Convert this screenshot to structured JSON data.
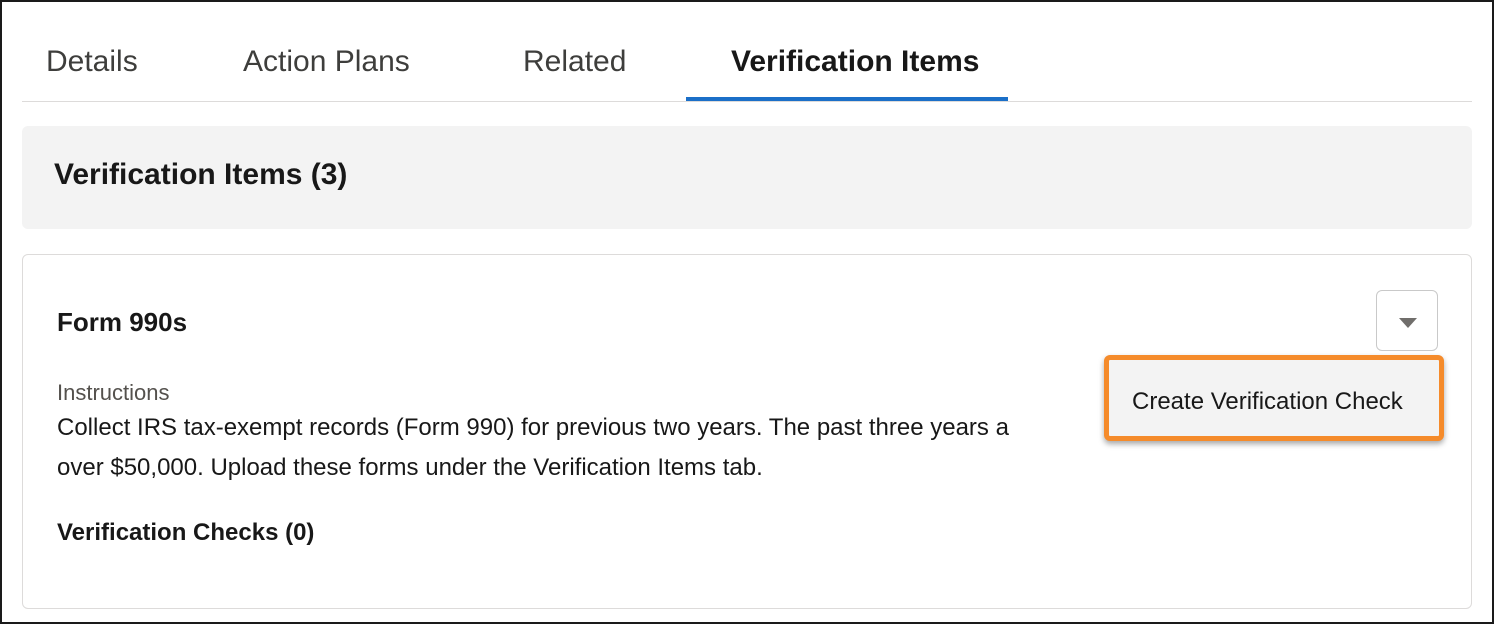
{
  "tabs": {
    "items": [
      {
        "label": "Details"
      },
      {
        "label": "Action Plans"
      },
      {
        "label": "Related"
      },
      {
        "label": "Verification Items"
      }
    ],
    "active": "Verification Items",
    "accent_color": "#1b6fc8"
  },
  "list": {
    "title": "Verification Items (3)"
  },
  "card": {
    "title": "Form 990s",
    "menu_icon": "chevron-down-icon",
    "instructions_label": "Instructions",
    "instructions_lines": [
      "Collect IRS tax-exempt records (Form 990) for previous two years. The past three years a",
      "over $50,000. Upload these forms under the Verification Items tab."
    ],
    "checks_title": "Verification Checks (0)"
  },
  "dropdown": {
    "highlighted_item": "Create Verification Check",
    "highlight_color": "#f58b2b"
  }
}
